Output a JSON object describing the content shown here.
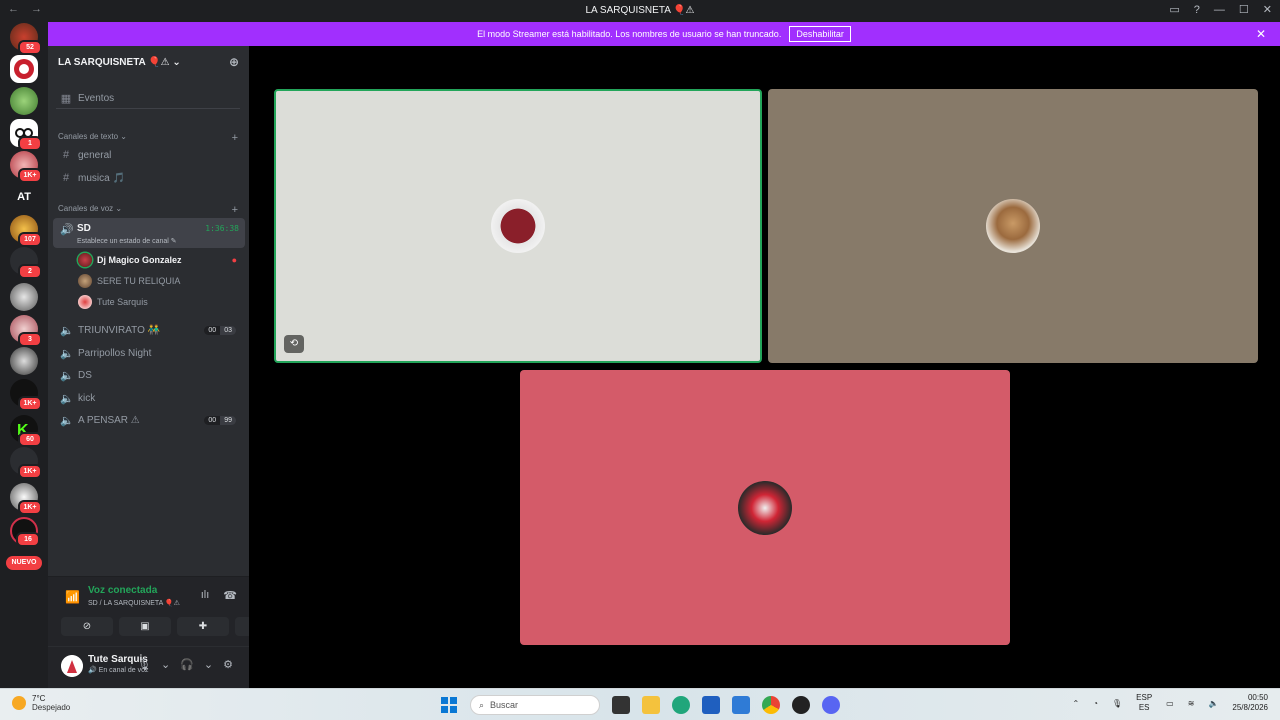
{
  "titlebar": {
    "back": "←",
    "forward": "→",
    "title": "LA SARQUISNETA 🎈⚠"
  },
  "banner": {
    "text": "El modo Streamer está habilitado. Los nombres de usuario se han truncado.",
    "button": "Deshabilitar",
    "close": "✕"
  },
  "rail": {
    "badges": [
      "52",
      "1",
      "1K+",
      "107",
      "2",
      "3",
      "1K+",
      "60",
      "1K+",
      "1K+",
      "16"
    ],
    "at_label": "AT",
    "nuevo_label": "NUEVO"
  },
  "guild": {
    "name": "LA SARQUISNETA 🎈⚠"
  },
  "channels": {
    "events": "Eventos",
    "text_category": "Canales de texto",
    "text": [
      "general",
      "musica 🎵"
    ],
    "voice_category": "Canales de voz",
    "active_voice": {
      "name": "SD",
      "status": "Establece un estado de canal",
      "timer": "1:36:38"
    },
    "members": [
      {
        "name": "Dj Magico Gonzalez",
        "speaking": true,
        "live": "●"
      },
      {
        "name": "SERE TU RELIQUIA",
        "speaking": false
      },
      {
        "name": "Tute Sarquis",
        "speaking": false
      }
    ],
    "voice": [
      {
        "name": "TRIUNVIRATO 👬",
        "count_a": "00",
        "count_b": "03"
      },
      {
        "name": "Parripollos Night"
      },
      {
        "name": "DS"
      },
      {
        "name": "kick"
      },
      {
        "name": "A PENSAR ⚠",
        "count_a": "00",
        "count_b": "99"
      }
    ]
  },
  "voice_panel": {
    "status": "Voz conectada",
    "location": "SD / LA SARQUISNETA 🎈⚠"
  },
  "user_panel": {
    "name": "Tute Sarquis",
    "status": "En canal de voz"
  },
  "tiles": [
    {
      "color": "#dcddd8",
      "active": true
    },
    {
      "color": "#877a69",
      "active": false
    },
    {
      "color": "#d45b69",
      "active": false
    }
  ],
  "taskbar": {
    "temp": "7°C",
    "weather": "Despejado",
    "search_placeholder": "Buscar",
    "lang_a": "ESP",
    "lang_b": "ES",
    "time": "00:50",
    "date": "25/8/2026"
  },
  "colors": {
    "accent_green": "#23a55a",
    "banner": "#a12ffe",
    "badge_red": "#f23f43"
  }
}
